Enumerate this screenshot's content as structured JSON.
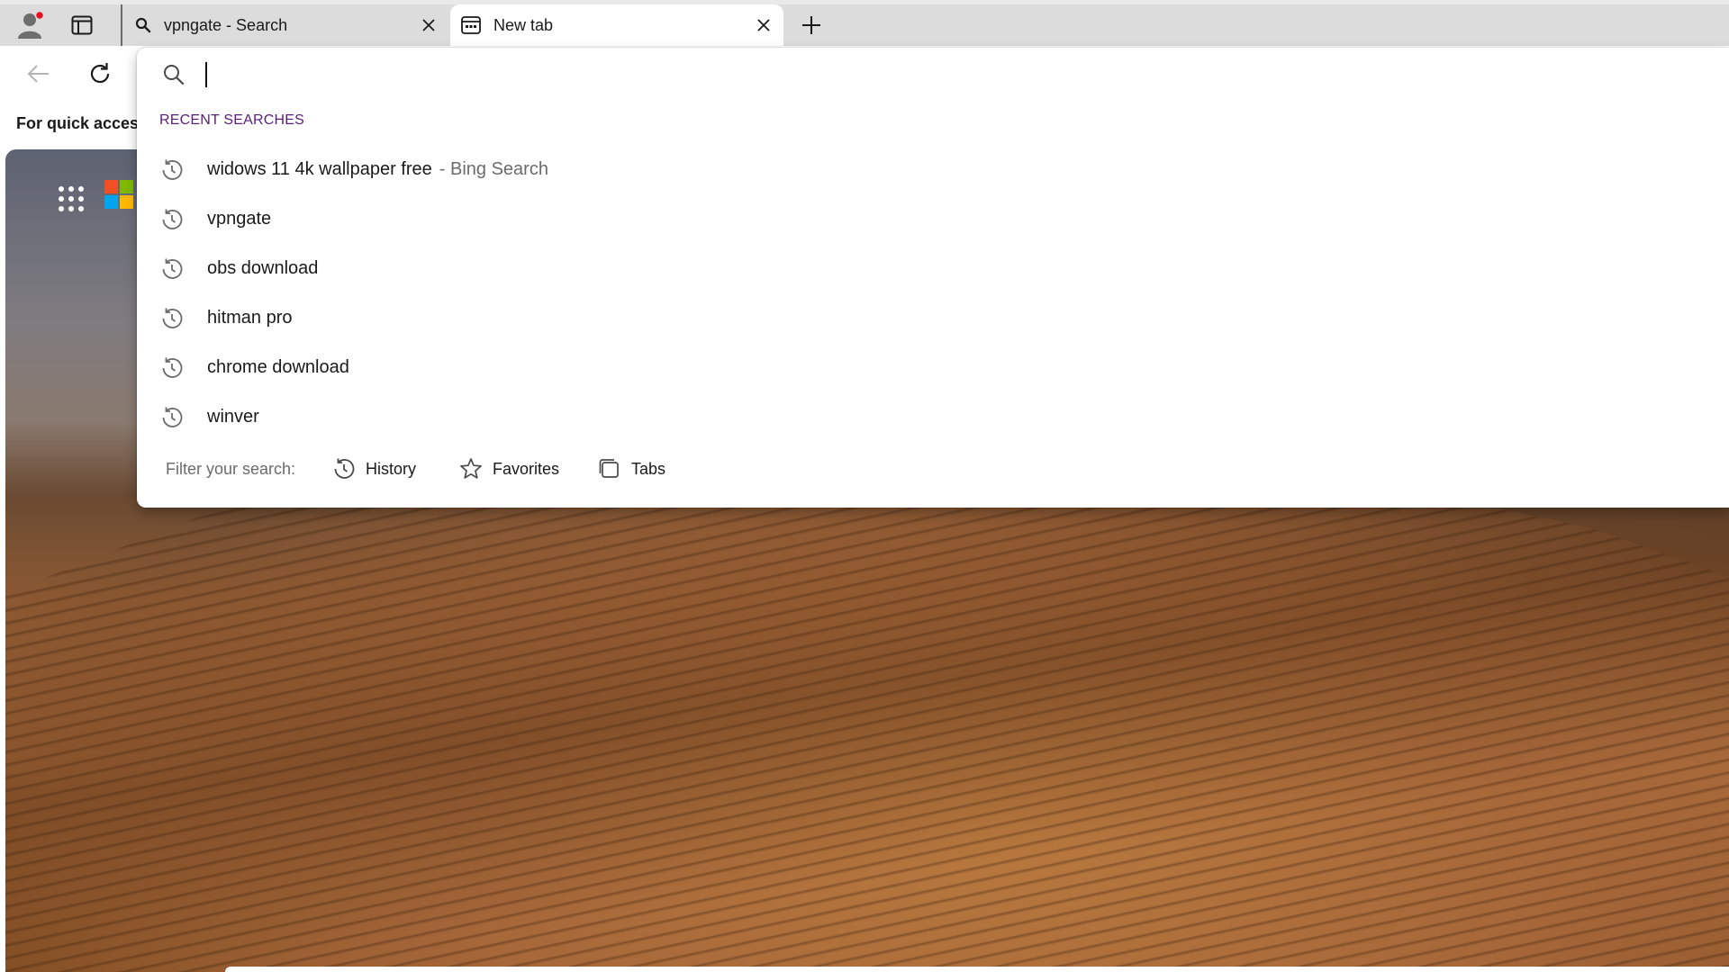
{
  "tabs": [
    {
      "title": "vpngate - Search",
      "icon": "search-icon",
      "active": false
    },
    {
      "title": "New tab",
      "icon": "new-tab-page-icon",
      "active": true
    }
  ],
  "favorites_bar": {
    "text": "For quick access"
  },
  "omnibox": {
    "value": "",
    "section_header": "RECENT SEARCHES",
    "suggestions": [
      {
        "text": "widows 11 4k wallpaper free",
        "suffix": "- Bing Search"
      },
      {
        "text": "vpngate",
        "suffix": ""
      },
      {
        "text": "obs download",
        "suffix": ""
      },
      {
        "text": "hitman pro",
        "suffix": ""
      },
      {
        "text": "chrome download",
        "suffix": ""
      },
      {
        "text": "winver",
        "suffix": ""
      }
    ],
    "filter": {
      "label": "Filter your search:",
      "options": [
        {
          "label": "History",
          "icon": "history-icon"
        },
        {
          "label": "Favorites",
          "icon": "star-icon"
        },
        {
          "label": "Tabs",
          "icon": "tabs-icon"
        }
      ]
    }
  },
  "colors": {
    "section_header": "#5a1e7a",
    "tabstrip": "#dcdcdc",
    "profile_badge": "#e81123",
    "ms_red": "#f25022",
    "ms_green": "#7fba00",
    "ms_blue": "#00a4ef",
    "ms_yellow": "#ffb900"
  }
}
